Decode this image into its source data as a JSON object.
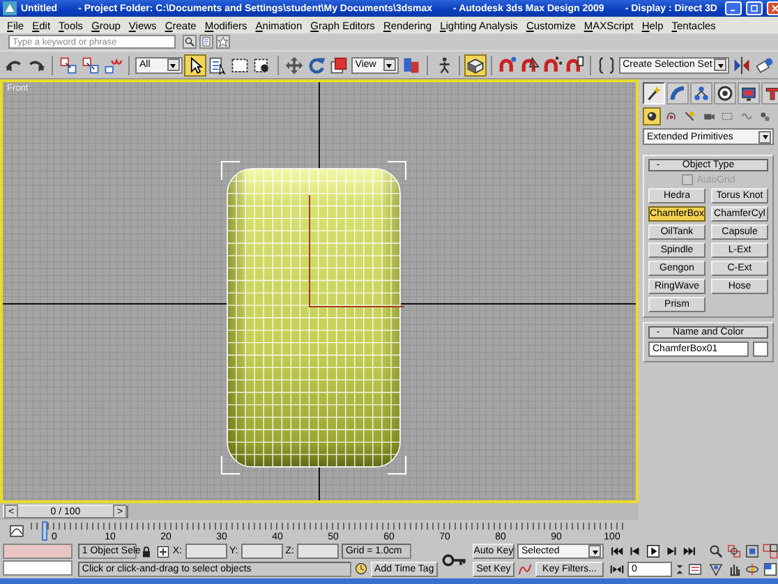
{
  "window": {
    "title": "Untitled",
    "project": "- Project Folder: C:\\Documents and Settings\\student\\My Documents\\3dsmax",
    "app": "- Autodesk 3ds Max Design 2009",
    "display": "- Display : Direct 3D"
  },
  "menu": [
    "File",
    "Edit",
    "Tools",
    "Group",
    "Views",
    "Create",
    "Modifiers",
    "Animation",
    "Graph Editors",
    "Rendering",
    "Lighting Analysis",
    "Customize",
    "MAXScript",
    "Help",
    "Tentacles"
  ],
  "search": {
    "placeholder": "Type a keyword or phrase"
  },
  "toolbar": {
    "items": [
      {
        "kind": "undo",
        "selected": false
      },
      {
        "kind": "redo",
        "selected": false
      },
      {
        "kind": "select-link",
        "selected": false
      },
      {
        "kind": "unlink",
        "selected": false
      },
      {
        "kind": "bind",
        "selected": false
      },
      {
        "kind": "dropdown",
        "value": "All"
      },
      {
        "kind": "select",
        "selected": true
      },
      {
        "kind": "select-by-name",
        "selected": false
      },
      {
        "kind": "rect-region",
        "selected": false
      },
      {
        "kind": "window-crossing",
        "selected": false
      },
      {
        "kind": "move",
        "selected": false
      },
      {
        "kind": "rotate",
        "selected": false
      },
      {
        "kind": "scale",
        "selected": false
      },
      {
        "kind": "dropdown",
        "value": "View"
      },
      {
        "kind": "pivot",
        "selected": false
      },
      {
        "kind": "manipulate",
        "selected": false
      },
      {
        "kind": "keyboard-shortcut",
        "selected": true
      },
      {
        "kind": "snap",
        "selected": false
      },
      {
        "kind": "angle-snap",
        "selected": false
      },
      {
        "kind": "percent-snap",
        "selected": false
      },
      {
        "kind": "spinner-snap",
        "selected": false
      },
      {
        "kind": "named-selection",
        "selected": false
      },
      {
        "kind": "dropdown",
        "value": "Create Selection Set"
      },
      {
        "kind": "mirror",
        "selected": false
      },
      {
        "kind": "align",
        "selected": false
      }
    ]
  },
  "viewport": {
    "label": "Front",
    "active": true
  },
  "command_panel": {
    "tabs": [
      {
        "kind": "create",
        "selected": true
      },
      {
        "kind": "modify",
        "selected": false
      },
      {
        "kind": "hierarchy",
        "selected": false
      },
      {
        "kind": "motion",
        "selected": false
      },
      {
        "kind": "display",
        "selected": false
      },
      {
        "kind": "utilities",
        "selected": false
      }
    ],
    "categories": [
      {
        "kind": "geometry",
        "selected": true
      },
      {
        "kind": "shapes",
        "selected": false
      },
      {
        "kind": "lights",
        "selected": false
      },
      {
        "kind": "cameras",
        "selected": false
      },
      {
        "kind": "helpers",
        "selected": false
      },
      {
        "kind": "space-warps",
        "selected": false
      },
      {
        "kind": "systems",
        "selected": false
      }
    ],
    "category_dropdown": "Extended Primitives",
    "object_type": {
      "collapse": "-",
      "title": "Object Type",
      "autogrid": {
        "label": "AutoGrid",
        "checked": false,
        "disabled": true
      },
      "buttons": [
        {
          "label": "Hedra",
          "selected": false
        },
        {
          "label": "Torus Knot",
          "selected": false
        },
        {
          "label": "ChamferBox",
          "selected": true
        },
        {
          "label": "ChamferCyl",
          "selected": false
        },
        {
          "label": "OilTank",
          "selected": false
        },
        {
          "label": "Capsule",
          "selected": false
        },
        {
          "label": "Spindle",
          "selected": false
        },
        {
          "label": "L-Ext",
          "selected": false
        },
        {
          "label": "Gengon",
          "selected": false
        },
        {
          "label": "C-Ext",
          "selected": false
        },
        {
          "label": "RingWave",
          "selected": false
        },
        {
          "label": "Hose",
          "selected": false
        },
        {
          "label": "Prism",
          "selected": false
        }
      ]
    },
    "name_and_color": {
      "collapse": "-",
      "title": "Name and Color",
      "name": "ChamferBox01",
      "color": "#ffffff"
    }
  },
  "time_slider": {
    "prev": "<",
    "reading": "0 / 100",
    "next": ">",
    "level": 0
  },
  "track_bar": {
    "ticks": [
      "0",
      "10",
      "20",
      "30",
      "40",
      "50",
      "60",
      "70",
      "80",
      "90",
      "100"
    ]
  },
  "status": {
    "selection": "1 Object Sele",
    "x": "X:",
    "y": "Y:",
    "z": "Z:",
    "grid": "Grid = 1.0cm",
    "prompt": "Click or click-and-drag to select objects",
    "time_tag": "Add Time Tag"
  },
  "animation": {
    "auto_key": "Auto Key",
    "auto_key_on": false,
    "key_mode": "Selected",
    "set_key": "Set Key",
    "key_filters": "Key Filters...",
    "frame": "0"
  }
}
